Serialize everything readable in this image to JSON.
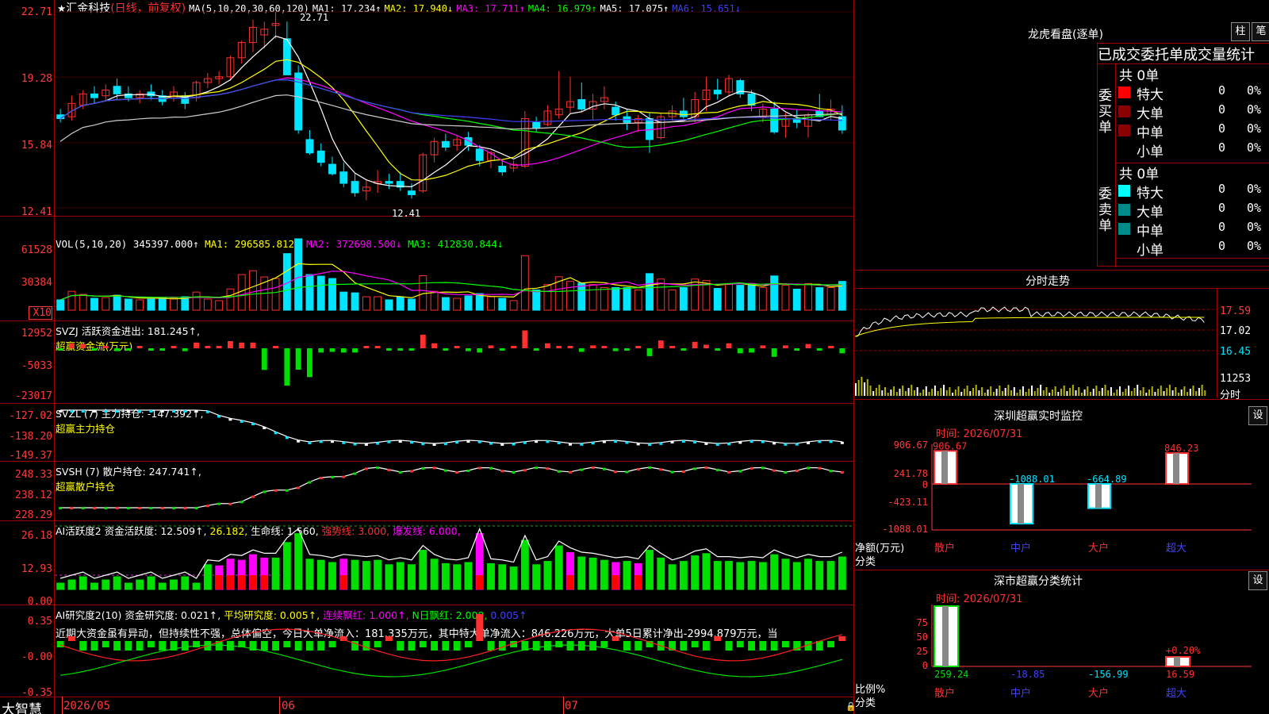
{
  "header": {
    "star": "★",
    "stock_name": "汇金科技",
    "period": "(日线，前复权)",
    "ma_label": "MA(5,10,20,30,60,120)",
    "ma1": "MA1: 17.234↑",
    "ma2": "MA2: 17.940↓",
    "ma3": "MA3: 17.711↑",
    "ma4": "MA4: 16.979↑",
    "ma5": "MA5: 17.075↑",
    "ma6": "MA6: 15.651↓",
    "high_marker": "22.71",
    "low_marker": "12.41"
  },
  "price_axis": [
    "22.71",
    "19.28",
    "15.84",
    "12.41"
  ],
  "vol": {
    "title": "VOL(5,10,20)",
    "val": "345397.000↑",
    "ma1": "MA1: 296585.812↑",
    "ma2": "MA2: 372698.500↓",
    "ma3": "MA3: 412830.844↓",
    "axis": [
      "61528",
      "30384",
      "X10"
    ]
  },
  "svzj": {
    "title": "SVZJ  活跃资金进出: 181.245↑,",
    "sub": "超赢资金流(万元)",
    "axis": [
      "12952",
      "-5033",
      "-23017"
    ]
  },
  "svzl": {
    "title": "SVZL (7) 主力持仓: -147.392↑,",
    "sub": "超赢主力持仓",
    "axis": [
      "-127.02",
      "-138.20",
      "-149.37"
    ]
  },
  "svsh": {
    "title": "SVSH (7) 散户持仓: 247.741↑,",
    "sub": "超赢散户持仓",
    "axis": [
      "248.33",
      "238.12",
      "228.29"
    ]
  },
  "ai1": {
    "title": "AI活跃度2 资金活跃度: 12.509↑,",
    "v2": "26.182,",
    "v3": "生命线: 1.560,",
    "v4": "强势线: 3.000,",
    "v5": "爆发线: 6.000,",
    "axis": [
      "26.18",
      "12.93",
      "0.00"
    ]
  },
  "ai2": {
    "title": "AI研究度2(10) 资金研究度: 0.021↑,",
    "v2": "平均研究度: 0.005↑,",
    "v3": "连续飘红: 1.000↑,",
    "v4": "N日飘红: 2.000,",
    "v5": "0.005↑",
    "text": "近期大资金虽有异动，但持续性不强，总体偏空，今日大单净流入：181.335万元，其中特大单净流入：846.226万元，大单5日累计净出-2994.879万元，当",
    "axis": [
      "0.35",
      "-0.00",
      "-0.35"
    ]
  },
  "date_axis": [
    "2026/05",
    "06",
    "07"
  ],
  "brand": "大智慧",
  "lhb": {
    "title": "龙虎看盘(逐单)",
    "btn1": "柱",
    "btn2": "笔",
    "tab": "已成交委托单成交量统计",
    "buy_label": "委买单",
    "sell_label": "委卖单",
    "buy_total": "共 0单",
    "sell_total": "共 0单",
    "rows": [
      "特大",
      "大单",
      "中单",
      "小单"
    ],
    "zero": "0",
    "pct": "0%"
  },
  "fenshi": {
    "title": "分时走势",
    "axis": [
      "17.59",
      "17.02",
      "16.45",
      "11253",
      "分时"
    ]
  },
  "sz_monitor": {
    "title": "深圳超赢实时监控",
    "btn": "设",
    "time": "时间: 2026/07/31",
    "axis": [
      "906.67",
      "241.78",
      "0",
      "-423.11",
      "-1088.01"
    ],
    "vals": [
      "906.67",
      "-1088.01",
      "-664.89",
      "846.23"
    ],
    "ylabel1": "净额(万元)",
    "ylabel2": "分类",
    "cats": [
      "散户",
      "中户",
      "大户",
      "超大"
    ]
  },
  "sz_class": {
    "title": "深市超赢分类统计",
    "btn": "设",
    "time": "时间: 2026/07/31",
    "axis": [
      "75",
      "50",
      "25",
      "0"
    ],
    "vals": [
      "259.24",
      "-18.85",
      "-156.99",
      "16.59"
    ],
    "pct_label": "+0.20%",
    "ylabel1": "比例%",
    "ylabel2": "分类",
    "cats": [
      "散户",
      "中户",
      "大户",
      "超大"
    ]
  },
  "colors": {
    "up": "#ff3030",
    "down": "#00e5ff",
    "grid": "#8b0000",
    "axis": "#ff3b3b"
  },
  "chart_data": {
    "type": "candlestick",
    "title": "汇金科技 (日线，前复权)",
    "x_range": [
      "2026/05",
      "2026/07"
    ],
    "ylim": [
      12.41,
      22.71
    ],
    "ohlc": [
      [
        17.3,
        17.6,
        16.9,
        17.1
      ],
      [
        17.2,
        18.3,
        17.0,
        17.9
      ],
      [
        17.8,
        18.6,
        17.6,
        18.4
      ],
      [
        18.4,
        18.8,
        17.9,
        18.2
      ],
      [
        18.3,
        18.9,
        18.0,
        18.6
      ],
      [
        18.8,
        19.2,
        18.1,
        18.4
      ],
      [
        18.4,
        18.8,
        18.0,
        18.2
      ],
      [
        18.2,
        18.6,
        17.9,
        18.4
      ],
      [
        18.5,
        18.9,
        18.1,
        18.3
      ],
      [
        18.3,
        18.6,
        17.8,
        18.0
      ],
      [
        18.2,
        18.8,
        18.0,
        18.5
      ],
      [
        18.3,
        18.5,
        17.6,
        17.9
      ],
      [
        18.2,
        19.1,
        18.0,
        19.0
      ],
      [
        19.0,
        19.5,
        18.7,
        19.2
      ],
      [
        19.2,
        19.6,
        18.9,
        19.3
      ],
      [
        19.3,
        20.4,
        19.1,
        20.3
      ],
      [
        20.3,
        21.2,
        20.0,
        21.1
      ],
      [
        21.1,
        22.3,
        20.6,
        21.9
      ],
      [
        21.5,
        22.2,
        20.8,
        21.8
      ],
      [
        22.0,
        22.7,
        21.3,
        22.1
      ],
      [
        21.3,
        22.2,
        19.4,
        19.4
      ],
      [
        19.5,
        19.9,
        16.3,
        16.5
      ],
      [
        16.0,
        16.5,
        15.2,
        15.3
      ],
      [
        15.4,
        15.8,
        14.6,
        14.8
      ],
      [
        14.7,
        15.1,
        14.1,
        14.2
      ],
      [
        14.3,
        14.8,
        13.5,
        13.7
      ],
      [
        13.8,
        14.2,
        13.0,
        13.2
      ],
      [
        13.3,
        13.9,
        12.8,
        13.5
      ],
      [
        13.7,
        14.4,
        13.2,
        13.8
      ],
      [
        13.8,
        14.2,
        13.4,
        13.7
      ],
      [
        13.8,
        14.3,
        13.3,
        13.5
      ],
      [
        13.3,
        13.7,
        12.9,
        13.1
      ],
      [
        13.3,
        15.3,
        13.2,
        15.2
      ],
      [
        15.2,
        16.1,
        14.8,
        15.9
      ],
      [
        15.9,
        16.3,
        15.4,
        15.6
      ],
      [
        15.7,
        16.2,
        15.4,
        16.0
      ],
      [
        16.1,
        16.4,
        15.4,
        15.7
      ],
      [
        15.5,
        15.7,
        14.6,
        14.9
      ],
      [
        14.9,
        15.4,
        14.5,
        15.3
      ],
      [
        14.6,
        14.9,
        14.1,
        14.3
      ],
      [
        14.5,
        14.9,
        14.3,
        14.7
      ],
      [
        14.6,
        17.5,
        14.5,
        17.1
      ],
      [
        16.9,
        17.2,
        16.4,
        16.6
      ],
      [
        16.8,
        17.8,
        16.7,
        17.5
      ],
      [
        17.3,
        19.6,
        17.1,
        17.6
      ],
      [
        17.7,
        19.3,
        17.4,
        18.0
      ],
      [
        18.1,
        19.0,
        17.5,
        17.6
      ],
      [
        17.6,
        18.4,
        17.0,
        18.0
      ],
      [
        18.0,
        18.8,
        17.6,
        18.2
      ],
      [
        17.7,
        18.0,
        17.0,
        17.3
      ],
      [
        17.2,
        17.6,
        16.5,
        16.9
      ],
      [
        16.9,
        17.3,
        16.4,
        17.1
      ],
      [
        17.1,
        17.4,
        15.3,
        16.0
      ],
      [
        16.1,
        17.4,
        16.0,
        17.2
      ],
      [
        17.2,
        17.8,
        17.0,
        17.5
      ],
      [
        17.5,
        18.2,
        17.1,
        17.2
      ],
      [
        17.2,
        18.5,
        16.9,
        18.1
      ],
      [
        18.1,
        19.3,
        17.5,
        18.6
      ],
      [
        18.6,
        19.2,
        18.1,
        18.4
      ],
      [
        18.5,
        19.4,
        18.3,
        19.2
      ],
      [
        19.1,
        19.2,
        18.2,
        18.4
      ],
      [
        18.4,
        18.6,
        17.5,
        17.8
      ],
      [
        17.2,
        17.9,
        16.9,
        17.6
      ],
      [
        17.6,
        18.0,
        16.3,
        16.4
      ],
      [
        16.7,
        17.4,
        16.1,
        17.1
      ],
      [
        17.1,
        17.6,
        16.6,
        16.9
      ],
      [
        16.7,
        17.4,
        16.1,
        17.3
      ],
      [
        17.5,
        18.4,
        17.3,
        17.2
      ],
      [
        17.3,
        18.1,
        17.0,
        17.6
      ],
      [
        17.2,
        17.8,
        16.3,
        16.5
      ]
    ]
  }
}
